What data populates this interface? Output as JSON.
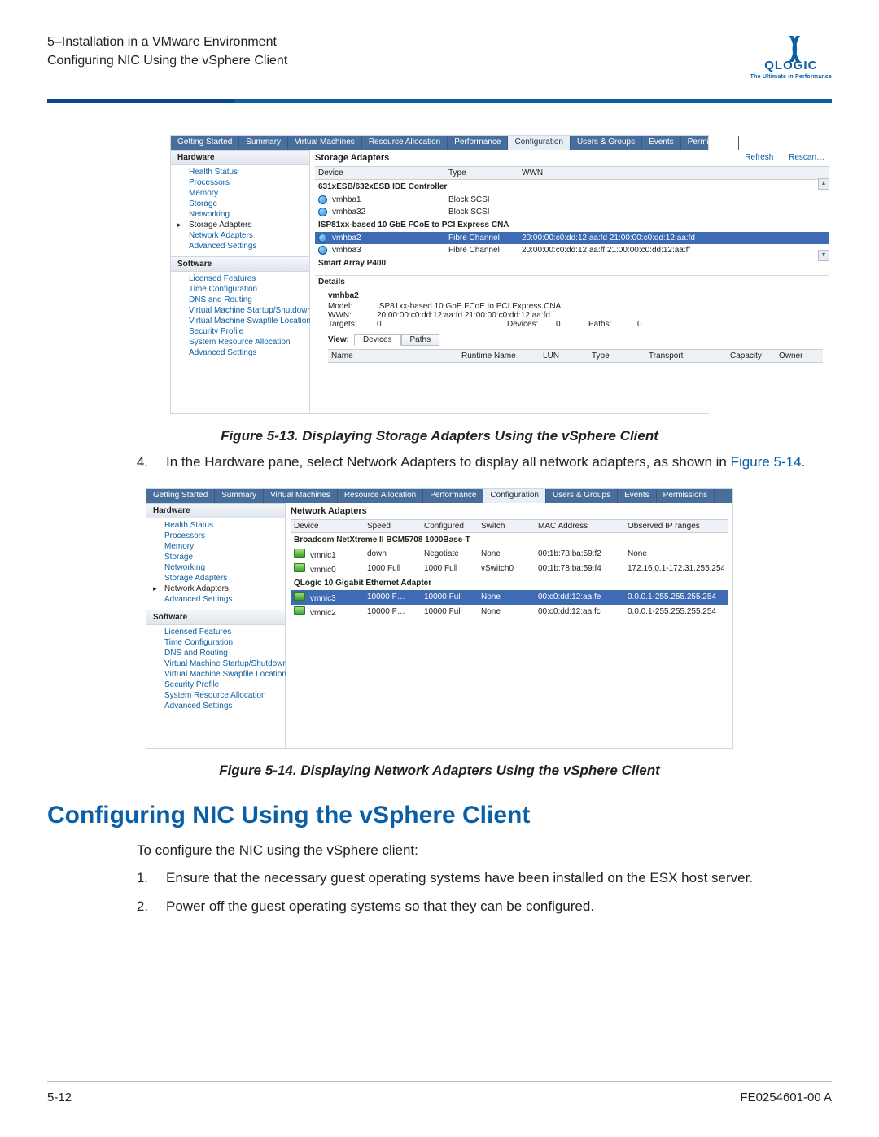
{
  "header": {
    "chapter": "5–Installation in a VMware Environment",
    "section": "Configuring NIC Using the vSphere Client",
    "logo_name": "QLOGIC",
    "logo_tag": "The Ultimate in Performance"
  },
  "figure1": {
    "tabs": [
      "Getting Started",
      "Summary",
      "Virtual Machines",
      "Resource Allocation",
      "Performance",
      "Configuration",
      "Users & Groups",
      "Events",
      "Permissions"
    ],
    "active_tab_index": 5,
    "sidebar": {
      "hw_title": "Hardware",
      "hw_items": [
        "Health Status",
        "Processors",
        "Memory",
        "Storage",
        "Networking",
        "Storage Adapters",
        "Network Adapters",
        "Advanced Settings"
      ],
      "hw_selected_index": 5,
      "sw_title": "Software",
      "sw_items": [
        "Licensed Features",
        "Time Configuration",
        "DNS and Routing",
        "Virtual Machine Startup/Shutdown",
        "Virtual Machine Swapfile Location",
        "Security Profile",
        "System Resource Allocation",
        "Advanced Settings"
      ]
    },
    "main_title": "Storage Adapters",
    "actions": {
      "refresh": "Refresh",
      "rescan": "Rescan…"
    },
    "headers": [
      "Device",
      "Type",
      "WWN"
    ],
    "groups": [
      {
        "name": "631xESB/632xESB IDE Controller",
        "rows": [
          {
            "device": "vmhba1",
            "type": "Block SCSI",
            "wwn": ""
          },
          {
            "device": "vmhba32",
            "type": "Block SCSI",
            "wwn": ""
          }
        ]
      },
      {
        "name": "ISP81xx-based 10 GbE FCoE to PCI Express CNA",
        "rows": [
          {
            "device": "vmhba2",
            "type": "Fibre Channel",
            "wwn": "20:00:00:c0:dd:12:aa:fd 21:00:00:c0:dd:12:aa:fd",
            "selected": true
          },
          {
            "device": "vmhba3",
            "type": "Fibre Channel",
            "wwn": "20:00:00:c0:dd:12:aa:ff 21:00:00:c0:dd:12:aa:ff"
          }
        ]
      },
      {
        "name": "Smart Array P400",
        "rows": []
      }
    ],
    "details_title": "Details",
    "details": {
      "name": "vmhba2",
      "model_label": "Model:",
      "model": "ISP81xx-based 10 GbE FCoE to PCI Express CNA",
      "wwn_label": "WWN:",
      "wwn": "20:00:00:c0:dd:12:aa:fd 21:00:00:c0:dd:12:aa:fd",
      "targets_label": "Targets:",
      "targets": "0",
      "devices_label": "Devices:",
      "devices": "0",
      "paths_label": "Paths:",
      "paths": "0"
    },
    "view_label": "View:",
    "view_tabs": [
      "Devices",
      "Paths"
    ],
    "dheaders": [
      "Name",
      "Runtime Name",
      "LUN",
      "Type",
      "Transport",
      "Capacity",
      "Owner"
    ],
    "caption": "Figure 5-13. Displaying Storage Adapters Using the vSphere Client"
  },
  "step4": {
    "num": "4.",
    "text_before": "In the Hardware pane, select Network Adapters to display all network adapters, as shown in ",
    "figlink": "Figure 5-14",
    "text_after": "."
  },
  "figure2": {
    "tabs": [
      "Getting Started",
      "Summary",
      "Virtual Machines",
      "Resource Allocation",
      "Performance",
      "Configuration",
      "Users & Groups",
      "Events",
      "Permissions"
    ],
    "active_tab_index": 5,
    "sidebar": {
      "hw_title": "Hardware",
      "hw_items": [
        "Health Status",
        "Processors",
        "Memory",
        "Storage",
        "Networking",
        "Storage Adapters",
        "Network Adapters",
        "Advanced Settings"
      ],
      "hw_selected_index": 6,
      "sw_title": "Software",
      "sw_items": [
        "Licensed Features",
        "Time Configuration",
        "DNS and Routing",
        "Virtual Machine Startup/Shutdown",
        "Virtual Machine Swapfile Location",
        "Security Profile",
        "System Resource Allocation",
        "Advanced Settings"
      ]
    },
    "main_title": "Network Adapters",
    "headers": [
      "Device",
      "Speed",
      "Configured",
      "Switch",
      "MAC Address",
      "Observed IP ranges"
    ],
    "groups": [
      {
        "name": "Broadcom NetXtreme II BCM5708 1000Base-T",
        "rows": [
          {
            "device": "vmnic1",
            "speed": "down",
            "conf": "Negotiate",
            "switch": "None",
            "mac": "00:1b:78:ba:59:f2",
            "ip": "None"
          },
          {
            "device": "vmnic0",
            "speed": "1000 Full",
            "conf": "1000 Full",
            "switch": "vSwitch0",
            "mac": "00:1b:78:ba:59:f4",
            "ip": "172.16.0.1-172.31.255.254"
          }
        ]
      },
      {
        "name": "QLogic 10 Gigabit Ethernet Adapter",
        "rows": [
          {
            "device": "vmnic3",
            "speed": "10000 F…",
            "conf": "10000 Full",
            "switch": "None",
            "mac": "00:c0:dd:12:aa:fe",
            "ip": "0.0.0.1-255.255.255.254",
            "selected": true
          },
          {
            "device": "vmnic2",
            "speed": "10000 F…",
            "conf": "10000 Full",
            "switch": "None",
            "mac": "00:c0:dd:12:aa:fc",
            "ip": "0.0.0.1-255.255.255.254"
          }
        ]
      }
    ],
    "caption": "Figure 5-14. Displaying Network Adapters Using the vSphere Client"
  },
  "h2": "Configuring NIC Using the vSphere Client",
  "intro": "To configure the NIC using the vSphere client:",
  "steps_b": [
    {
      "num": "1.",
      "text": "Ensure that the necessary guest operating systems have been installed on the ESX host server."
    },
    {
      "num": "2.",
      "text": "Power off the guest operating systems so that they can be configured."
    }
  ],
  "footer": {
    "page": "5-12",
    "docid": "FE0254601-00 A"
  }
}
